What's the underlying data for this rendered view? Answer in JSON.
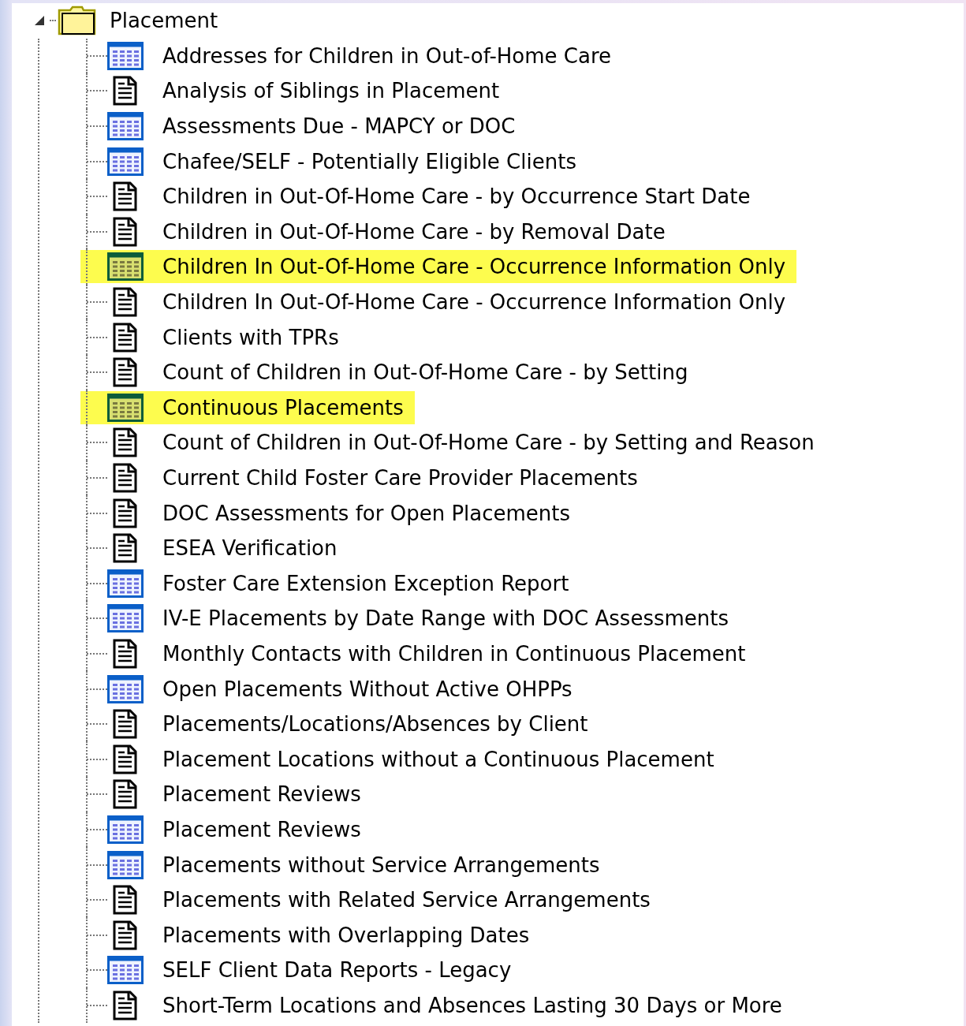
{
  "tree": {
    "label": "Placement",
    "expanded": true,
    "children": [
      {
        "label": "Addresses for Children in Out-of-Home Care",
        "kind": "table",
        "highlighted": false
      },
      {
        "label": "Analysis of Siblings in Placement",
        "kind": "document",
        "highlighted": false
      },
      {
        "label": "Assessments Due - MAPCY or DOC",
        "kind": "table",
        "highlighted": false
      },
      {
        "label": "Chafee/SELF - Potentially Eligible Clients",
        "kind": "table",
        "highlighted": false
      },
      {
        "label": "Children in Out-Of-Home Care - by Occurrence Start Date",
        "kind": "document",
        "highlighted": false
      },
      {
        "label": "Children in Out-Of-Home Care - by Removal Date",
        "kind": "document",
        "highlighted": false
      },
      {
        "label": "Children In Out-Of-Home Care - Occurrence Information Only",
        "kind": "table",
        "highlighted": true
      },
      {
        "label": "Children In Out-Of-Home Care - Occurrence Information Only",
        "kind": "document",
        "highlighted": false
      },
      {
        "label": "Clients with TPRs",
        "kind": "document",
        "highlighted": false
      },
      {
        "label": "Count of Children in Out-Of-Home Care - by Setting",
        "kind": "document",
        "highlighted": false
      },
      {
        "label": "Continuous Placements",
        "kind": "table",
        "highlighted": true
      },
      {
        "label": "Count of Children in Out-Of-Home Care - by Setting and Reason",
        "kind": "document",
        "highlighted": false
      },
      {
        "label": "Current Child Foster Care Provider Placements",
        "kind": "document",
        "highlighted": false
      },
      {
        "label": "DOC Assessments for Open Placements",
        "kind": "document",
        "highlighted": false
      },
      {
        "label": "ESEA Verification",
        "kind": "document",
        "highlighted": false
      },
      {
        "label": "Foster Care Extension Exception Report",
        "kind": "table",
        "highlighted": false
      },
      {
        "label": "IV-E Placements by Date Range with DOC Assessments",
        "kind": "table",
        "highlighted": false
      },
      {
        "label": "Monthly Contacts with Children in Continuous Placement",
        "kind": "document",
        "highlighted": false
      },
      {
        "label": "Open Placements Without Active OHPPs",
        "kind": "table",
        "highlighted": false
      },
      {
        "label": "Placements/Locations/Absences by Client",
        "kind": "document",
        "highlighted": false
      },
      {
        "label": "Placement Locations without a Continuous Placement",
        "kind": "document",
        "highlighted": false
      },
      {
        "label": "Placement Reviews",
        "kind": "document",
        "highlighted": false
      },
      {
        "label": "Placement Reviews",
        "kind": "table",
        "highlighted": false
      },
      {
        "label": "Placements without Service Arrangements",
        "kind": "table",
        "highlighted": false
      },
      {
        "label": "Placements with Related Service Arrangements",
        "kind": "document",
        "highlighted": false
      },
      {
        "label": "Placements with Overlapping Dates",
        "kind": "document",
        "highlighted": false
      },
      {
        "label": "SELF Client Data Reports - Legacy",
        "kind": "table",
        "highlighted": false
      },
      {
        "label": "Short-Term Locations and Absences Lasting 30 Days or More",
        "kind": "document",
        "highlighted": false
      }
    ]
  }
}
